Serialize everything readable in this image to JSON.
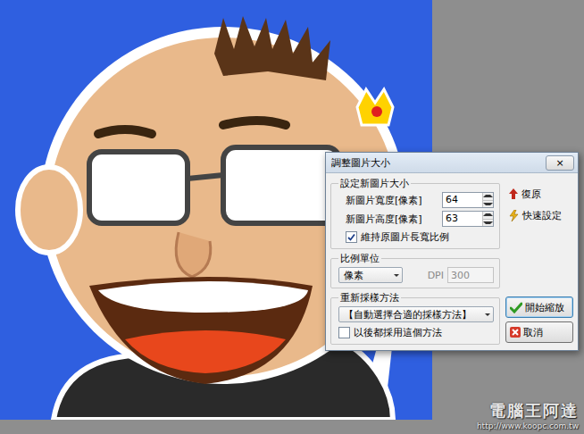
{
  "canvas": {
    "watermark": "電腦王阿達",
    "watermark_url": "http://www.koopc.com.tw"
  },
  "dialog": {
    "title": "調整圖片大小",
    "close": "×",
    "size_group": {
      "title": "設定新圖片大小",
      "fields": [
        {
          "label": "新圖片寬度[像素]",
          "value": "64"
        },
        {
          "label": "新圖片高度[像素]",
          "value": "63"
        }
      ],
      "keep_ratio": {
        "label": "維持原圖片長寬比例",
        "checked": true
      }
    },
    "unit_group": {
      "title": "比例單位",
      "unit": "像素",
      "dpi_label": "DPI",
      "dpi_value": "300",
      "dpi_disabled": true
    },
    "resample_group": {
      "title": "重新採樣方法",
      "method": "【自動選擇合適的採樣方法】",
      "remember": {
        "label": "以後都採用這個方法",
        "checked": false
      }
    },
    "links": [
      {
        "label": "復原"
      },
      {
        "label": "快速設定"
      }
    ],
    "buttons": [
      {
        "label": "開始縮放",
        "kind": "ok"
      },
      {
        "label": "取消",
        "kind": "cancel"
      }
    ]
  }
}
